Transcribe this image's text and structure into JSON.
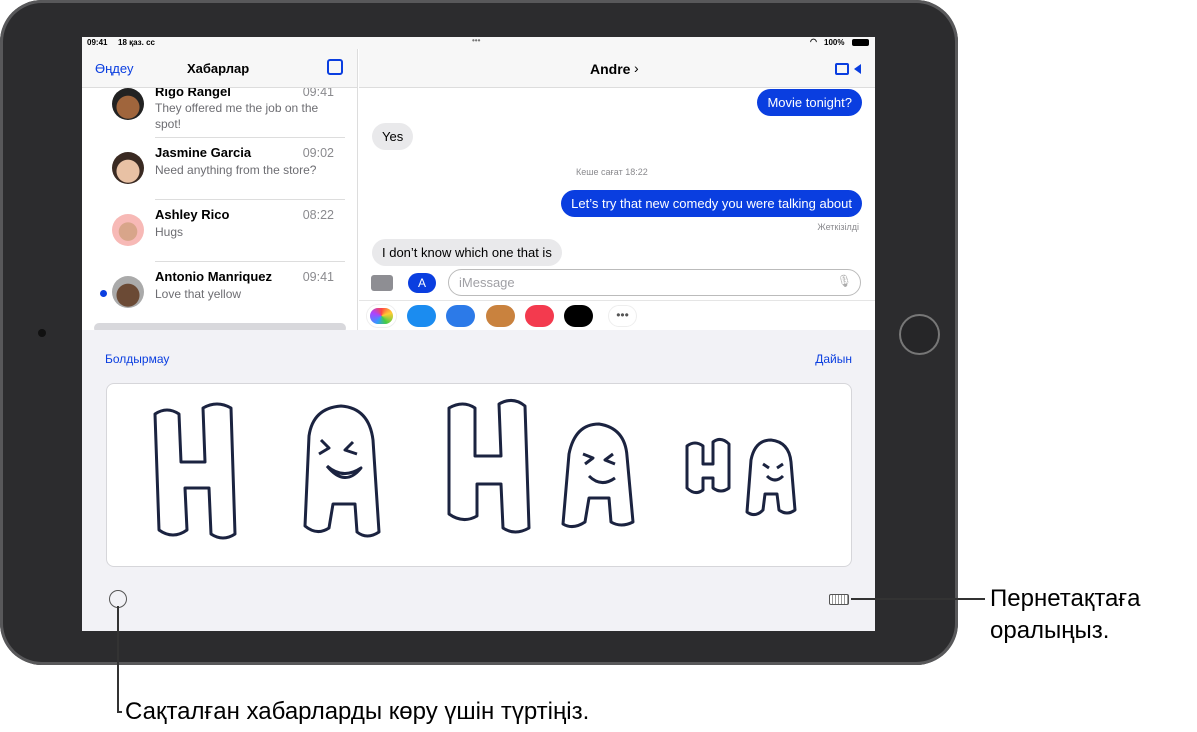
{
  "status": {
    "time": "09:41",
    "date": "18 қаз. сс",
    "battery": "100%"
  },
  "sidebar": {
    "edit": "Өңдеу",
    "title": "Хабарлар",
    "conversations": [
      {
        "name": "Rigo Rangel",
        "time": "09:41",
        "preview": "They offered me the job on the spot!",
        "unread": false
      },
      {
        "name": "Jasmine Garcia",
        "time": "09:02",
        "preview": "Need anything from the store?",
        "unread": false
      },
      {
        "name": "Ashley Rico",
        "time": "08:22",
        "preview": "Hugs",
        "unread": false
      },
      {
        "name": "Antonio Manriquez",
        "time": "09:41",
        "preview": "Love that yellow",
        "unread": true
      }
    ]
  },
  "chat": {
    "contact": "Andre",
    "messages": [
      {
        "text": "Movie tonight?",
        "from": "me"
      },
      {
        "text": "Yes",
        "from": "them"
      },
      {
        "text": "Let’s try that new comedy you were talking about",
        "from": "me"
      },
      {
        "text": "I don’t know which one that is",
        "from": "them"
      }
    ],
    "timestamp": "Кеше сағат 18:22",
    "delivered": "Жеткізілді",
    "input_placeholder": "iMessage"
  },
  "handwriting": {
    "cancel": "Болдырмау",
    "done": "Дайын",
    "drawn_text": "HAHAha"
  },
  "callouts": {
    "keyboard": [
      "Пернетақтаға",
      "оралыңыз."
    ],
    "history": "Сақталған хабарларды көру үшін түртіңіз."
  },
  "colors": {
    "accent": "#0a3ee0",
    "bubble_in": "#e9e9eb",
    "ink": "#1b2340"
  }
}
